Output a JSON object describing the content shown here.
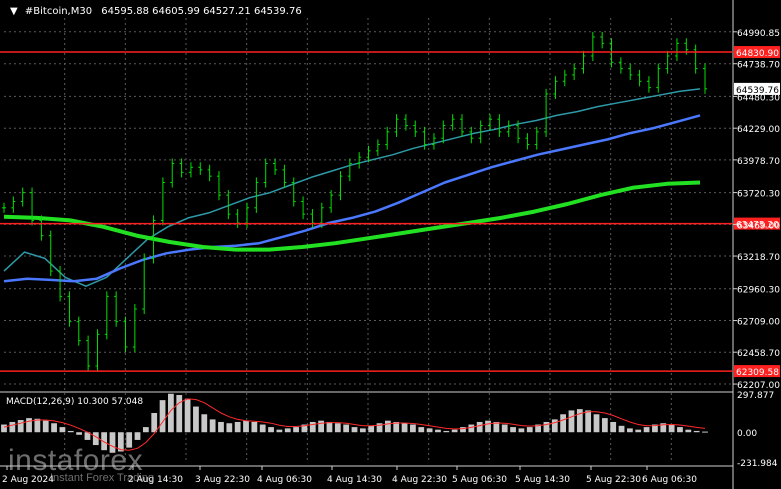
{
  "header": {
    "symbol": "#Bitcoin,M30",
    "ohlc": "64595.88 64605.99 64527.21 64539.76"
  },
  "chart_data": {
    "type": "line",
    "title": "#Bitcoin,M30",
    "price_axis": {
      "ticks": [
        "64990.85",
        "64738.70",
        "64480.30",
        "64229.00",
        "63978.70",
        "63720.30",
        "63469.00",
        "63218.70",
        "62960.30",
        "62709.00",
        "62458.70",
        "62207.00"
      ],
      "ylim": [
        62160,
        65100
      ]
    },
    "time_axis": {
      "labels": [
        "2 Aug 2024",
        "2 Aug 14:30",
        "3 Aug 22:30",
        "4 Aug 06:30",
        "4 Aug 14:30",
        "4 Aug 22:30",
        "5 Aug 06:30",
        "5 Aug 14:30",
        "5 Aug 22:30",
        "6 Aug 06:30"
      ]
    },
    "horizontal_levels": [
      {
        "value": 64830.9,
        "label": "64830.90",
        "color": "#ff2020"
      },
      {
        "value": 63475.2,
        "label": "63475.20",
        "color": "#ff2020"
      },
      {
        "value": 62309.58,
        "label": "62309.58",
        "color": "#ff2020"
      }
    ],
    "current_price": {
      "value": 64539.76,
      "label": "64539.76"
    },
    "price_series": {
      "name": "",
      "color": "#00e000",
      "values": [
        63600,
        63650,
        63720,
        63500,
        63380,
        63100,
        62900,
        62700,
        62550,
        62350,
        62600,
        62900,
        62700,
        62500,
        62800,
        63200,
        63500,
        63800,
        63950,
        63880,
        63920,
        63900,
        63850,
        63700,
        63550,
        63480,
        63600,
        63800,
        63950,
        63900,
        63800,
        63650,
        63550,
        63480,
        63600,
        63700,
        63850,
        63950,
        64000,
        64050,
        64100,
        64200,
        64300,
        64250,
        64200,
        64100,
        64150,
        64250,
        64300,
        64200,
        64150,
        64250,
        64300,
        64200,
        64250,
        64150,
        64100,
        64200,
        64500,
        64600,
        64650,
        64700,
        64800,
        64950,
        64900,
        64750,
        64700,
        64650,
        64600,
        64550,
        64700,
        64800,
        64900,
        64850,
        64700,
        64540
      ]
    },
    "ma_series": [
      {
        "color": "#2e9aa8",
        "values": [
          63100,
          63250,
          63200,
          63050,
          62980,
          63050,
          63200,
          63350,
          63450,
          63520,
          63560,
          63620,
          63680,
          63720,
          63780,
          63840,
          63890,
          63940,
          63980,
          64020,
          64070,
          64110,
          64150,
          64190,
          64220,
          64260,
          64290,
          64330,
          64360,
          64400,
          64430,
          64460,
          64490,
          64520,
          64540
        ]
      },
      {
        "color": "#4a78ff",
        "values": [
          63020,
          63040,
          63030,
          63020,
          63040,
          63120,
          63190,
          63240,
          63270,
          63290,
          63300,
          63320,
          63370,
          63420,
          63480,
          63520,
          63570,
          63640,
          63720,
          63800,
          63860,
          63920,
          63970,
          64020,
          64060,
          64100,
          64140,
          64190,
          64230,
          64280,
          64330
        ]
      },
      {
        "color": "#22e022",
        "values": [
          63530,
          63520,
          63500,
          63450,
          63380,
          63330,
          63290,
          63270,
          63270,
          63290,
          63320,
          63360,
          63400,
          63440,
          63480,
          63520,
          63570,
          63630,
          63700,
          63760,
          63790,
          63800
        ]
      }
    ],
    "macd": {
      "label": "MACD(12,26,9) 10.300 57.048",
      "ticks": [
        "297.877",
        "0.00",
        "-231.984"
      ],
      "ylim": [
        -231.984,
        297.877
      ],
      "histogram": [
        60,
        80,
        95,
        110,
        105,
        90,
        70,
        40,
        10,
        -20,
        -60,
        -100,
        -140,
        -160,
        -150,
        -120,
        -60,
        40,
        150,
        250,
        300,
        290,
        260,
        200,
        140,
        100,
        80,
        70,
        80,
        90,
        80,
        60,
        40,
        20,
        30,
        40,
        60,
        80,
        90,
        80,
        70,
        60,
        40,
        30,
        50,
        70,
        90,
        80,
        70,
        60,
        40,
        30,
        20,
        10,
        20,
        40,
        60,
        80,
        90,
        80,
        60,
        40,
        30,
        40,
        60,
        80,
        100,
        140,
        170,
        180,
        170,
        140,
        110,
        80,
        50,
        30,
        20,
        40,
        60,
        70,
        60,
        40,
        20,
        10,
        5
      ],
      "signal": [
        40,
        55,
        70,
        85,
        95,
        95,
        88,
        75,
        55,
        30,
        0,
        -35,
        -75,
        -110,
        -135,
        -140,
        -125,
        -80,
        -10,
        80,
        170,
        230,
        260,
        255,
        230,
        190,
        150,
        120,
        100,
        90,
        85,
        80,
        70,
        55,
        45,
        45,
        50,
        60,
        70,
        75,
        75,
        70,
        60,
        50,
        50,
        55,
        65,
        72,
        72,
        68,
        60,
        50,
        40,
        30,
        25,
        28,
        38,
        52,
        65,
        72,
        70,
        62,
        52,
        48,
        50,
        60,
        75,
        95,
        120,
        145,
        160,
        160,
        150,
        130,
        105,
        80,
        60,
        50,
        52,
        58,
        60,
        56,
        48,
        38,
        30
      ]
    },
    "grid": true
  },
  "watermark": {
    "brand": "instaforex",
    "tagline": "Instant Forex Trading"
  }
}
